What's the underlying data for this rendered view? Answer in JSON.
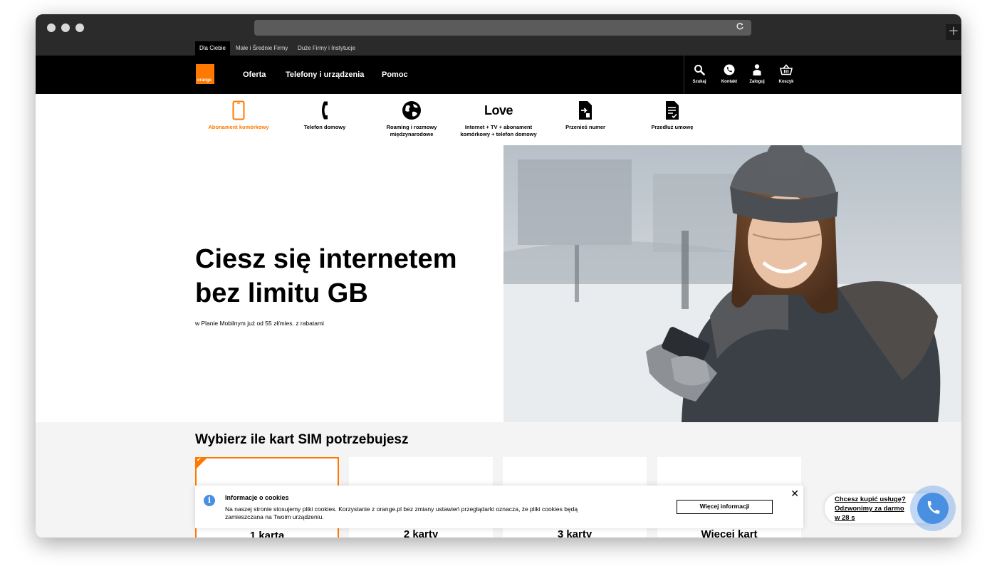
{
  "browser": {
    "url": "",
    "new_tab_symbol": "+"
  },
  "top_nav": [
    "Dla Ciebie",
    "Małe i Średnie Firmy",
    "Duże Firmy i Instytucje"
  ],
  "brand": {
    "logo_text": "orange",
    "accent": "#ff7900"
  },
  "main_nav": [
    "Oferta",
    "Telefony i urządzenia",
    "Pomoc"
  ],
  "nav_icons": [
    {
      "label": "Szukaj",
      "icon": "search-icon"
    },
    {
      "label": "Kontakt",
      "icon": "phone-icon"
    },
    {
      "label": "Zaloguj",
      "icon": "user-icon"
    },
    {
      "label": "Koszyk",
      "icon": "basket-icon"
    }
  ],
  "categories": [
    {
      "label": "Abonament komórkowy",
      "icon": "smartphone-icon",
      "active": true
    },
    {
      "label": "Telefon domowy",
      "icon": "handset-icon"
    },
    {
      "label": "Roaming i rozmowy międzynarodowe",
      "icon": "globe-icon"
    },
    {
      "label": "Internet + TV + abonament komórkowy + telefon domowy",
      "icon": "love-logo",
      "logo_text": "Love"
    },
    {
      "label": "Przenieś numer",
      "icon": "sim-transfer-icon"
    },
    {
      "label": "Przedłuż umowę",
      "icon": "document-icon"
    }
  ],
  "hero": {
    "title": "Ciesz się internetem bez limitu GB",
    "subtitle": "w Planie Mobilnym już od 55 zł/mies. z rabatami"
  },
  "sim": {
    "title": "Wybierz ile kart SIM potrzebujesz",
    "cards": [
      "1 karta",
      "2 karty",
      "3 karty",
      "Więcej kart"
    ]
  },
  "cookies": {
    "title": "Informacje o cookies",
    "text": "Na naszej stronie stosujemy pliki cookies. Korzystanie z orange.pl bez zmiany ustawień przeglądarki oznacza, że pliki cookies będą zamieszczana na Twoim urządzeniu.",
    "button": "Więcej informacji",
    "close": "✕",
    "info": "i"
  },
  "callback": {
    "line1": "Chcesz kupić usługę?",
    "line2": "Odzwonimy za darmo",
    "line3": "w 28 s"
  }
}
